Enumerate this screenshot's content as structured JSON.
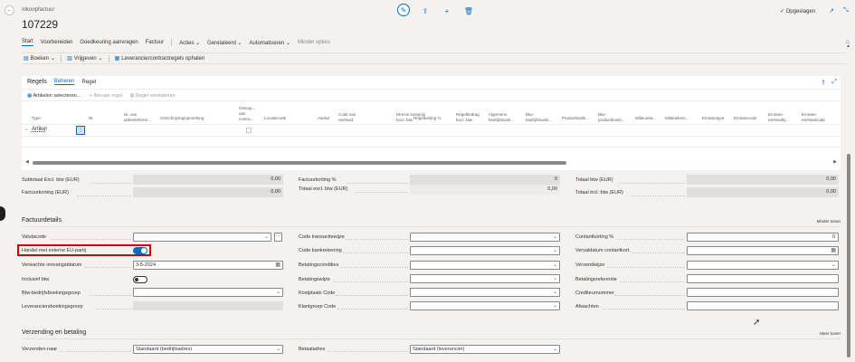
{
  "header": {
    "breadcrumb": "Inkoopfactuur",
    "title": "107229",
    "saved_status": "✓ Opgeslagen"
  },
  "actionbar": {
    "tabs": [
      "Start",
      "Voorbereiden",
      "Goedkeuring aanvragen",
      "Factuur",
      "Acties",
      "Gerelateerd",
      "Automatiseren",
      "Minder opties"
    ],
    "sub": {
      "boeken": "Boeken",
      "vrijgeven": "Vrijgeven",
      "leverancier": "Leveranciercontractregels ophalen"
    }
  },
  "lines": {
    "title": "Regels",
    "tabs": [
      "Beheren",
      "Regel"
    ],
    "tools": {
      "artikelen": "Artikelen selecteren...",
      "nieuwe": "Nieuwe regel",
      "verwijderen": "Regel verwijderen"
    },
    "columns": [
      {
        "l": "Type"
      },
      {
        "l": "Nr."
      },
      {
        "l": "Nr. van artikelreferen..."
      },
      {
        "l": "Omschrijving/opmerking"
      },
      {
        "l": "Geloop... aan contra..."
      },
      {
        "l": "Locatiecode"
      },
      {
        "l": "Aantal"
      },
      {
        "l": "Code van eenheid"
      },
      {
        "l": "Directe kostprijs Excl. btw"
      },
      {
        "l": "Regelkorting %"
      },
      {
        "l": "Regelbedrag Excl. btw"
      },
      {
        "l": "Algemene bedrijfsboek..."
      },
      {
        "l": "Btw-bedrijfsboeki..."
      },
      {
        "l": "Productboeki..."
      },
      {
        "l": "Btw-productboeki..."
      },
      {
        "l": "Milieureta..."
      },
      {
        "l": "Milieuekeni..."
      },
      {
        "l": "Emissietype"
      },
      {
        "l": "Emissiecode"
      },
      {
        "l": "Emissie-eenheidty..."
      },
      {
        "l": "Emissie-eenheidcode"
      }
    ],
    "row1_type": "Artikel"
  },
  "totals": {
    "subtotaal_lbl": "Subtotaal Excl. btw (EUR)",
    "subtotaal_val": "0,00",
    "factuurkorting_lbl": "Factuurkorting (EUR)",
    "factuurkorting_val": "0,00",
    "factuurkortingpct_lbl": "Factuurkorting %",
    "factuurkortingpct_val": "0",
    "totaalexcl_lbl": "Totaal excl. btw (EUR)",
    "totaalexcl_val": "0,00",
    "totaalbtw_lbl": "Totaal btw (EUR)",
    "totaalbtw_val": "0,00",
    "totaalincl_lbl": "Totaal incl. btw (EUR)",
    "totaalincl_val": "0,00"
  },
  "factuurdetails": {
    "title": "Factuurdetails",
    "toggle_link": "Minder tonen",
    "valutacode": "Valutacode",
    "handel": "Handel met externe EU-partij",
    "verwachte": "Verwachte ontvangstdatum",
    "verwachte_val": "3-5-2024",
    "inclusief": "Inclusief btw",
    "btw_bedrijf": "Btw-bedrijfsboekingsgroep",
    "lev_boek": "Leveranciersboekingsgroep",
    "code_trans": "Code transactiewijze",
    "code_bank": "Code bankrekening",
    "betalingscond": "Betalingscondities",
    "betalingswijze": "Betalingswijze",
    "kostplaats": "Kostplaats Code",
    "klantgroep": "Klantgroep Code",
    "contant_pct": "Contantkorting %",
    "contant_pct_val": "0",
    "vervaldatum": "Vervaldatum contantkort.",
    "verzendwijze": "Verzendwijze",
    "betalingsref": "Betalingsreferentie",
    "crediteur": "Crediteurnummer",
    "afwachten": "Afwachten"
  },
  "verzending": {
    "title": "Verzending en betaling",
    "toggle_link": "Meer tonen",
    "verzenden_naar": "Verzenden-naar",
    "verzenden_naar_val": "Standaard (bedrijfsadres)",
    "betaaladres": "Betaaladres",
    "betaaladres_val": "Standaard (leverancier)"
  }
}
